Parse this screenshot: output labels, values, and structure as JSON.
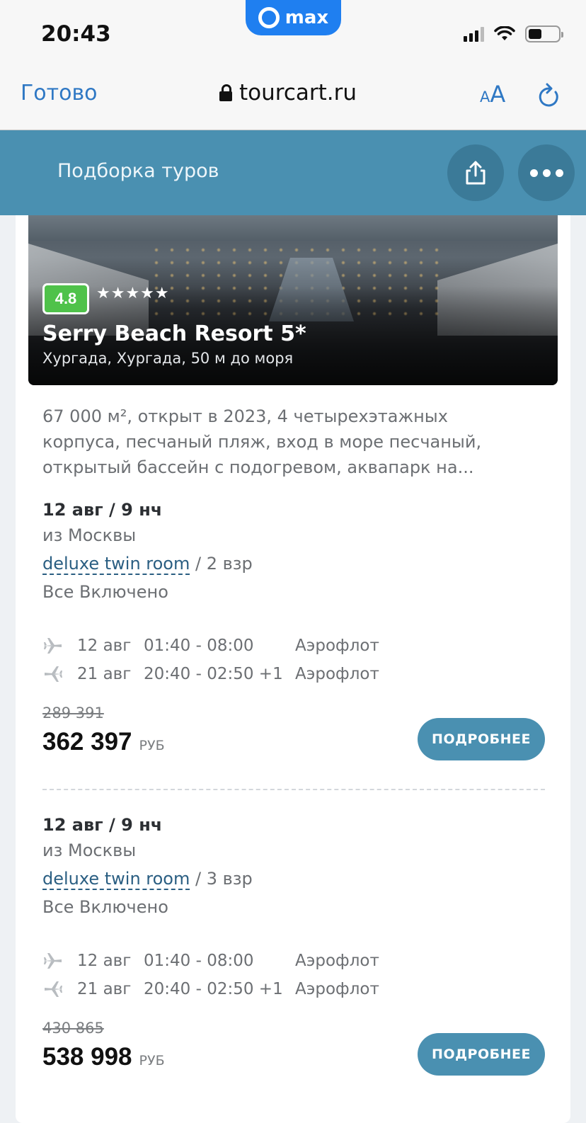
{
  "status_bar": {
    "time": "20:43",
    "pill_label": "max"
  },
  "browser": {
    "done_label": "Готово",
    "url": "tourcart.ru",
    "text_size_small": "A",
    "text_size_large": "A"
  },
  "header": {
    "title": "Подборка туров"
  },
  "hotel": {
    "rating": "4.8",
    "stars": "★★★★★",
    "name": "Serry Beach Resort 5*",
    "location": "Хургада, Хургада, 50 м до моря",
    "description": "67 000 м², открыт в 2023, 4 четырехэтажных корпуса, песчаный пляж, вход в море песчаный, открытый бассейн с подогревом, аквапарк на..."
  },
  "offers": [
    {
      "dates": "12 авг / 9 нч",
      "departure": "из Москвы",
      "room": "deluxe twin room",
      "guests": " / 2 взр",
      "meal": "Все Включено",
      "flights": [
        {
          "date": "12 авг",
          "time": "01:40 - 08:00",
          "airline": "Аэрофлот"
        },
        {
          "date": "21 авг",
          "time": "20:40 - 02:50 +1",
          "airline": "Аэрофлот"
        }
      ],
      "old_price": "289 391",
      "price": "362 397",
      "currency": "РУБ",
      "button": "ПОДРОБНЕЕ"
    },
    {
      "dates": "12 авг / 9 нч",
      "departure": "из Москвы",
      "room": "deluxe twin room",
      "guests": " / 3 взр",
      "meal": "Все Включено",
      "flights": [
        {
          "date": "12 авг",
          "time": "01:40 - 08:00",
          "airline": "Аэрофлот"
        },
        {
          "date": "21 авг",
          "time": "20:40 - 02:50 +1",
          "airline": "Аэрофлот"
        }
      ],
      "old_price": "430 865",
      "price": "538 998",
      "currency": "РУБ",
      "button": "ПОДРОБНЕЕ"
    }
  ],
  "colors": {
    "header_bg": "#4a90b1",
    "link": "#2f78c4",
    "rating_bg": "#4fc24a",
    "button_bg": "#4a90b1"
  },
  "icons": [
    "lock-icon",
    "text-size-icon",
    "reload-icon",
    "share-icon",
    "more-icon",
    "plane-depart-icon",
    "plane-arrive-icon",
    "signal-icon",
    "wifi-icon",
    "battery-icon"
  ]
}
